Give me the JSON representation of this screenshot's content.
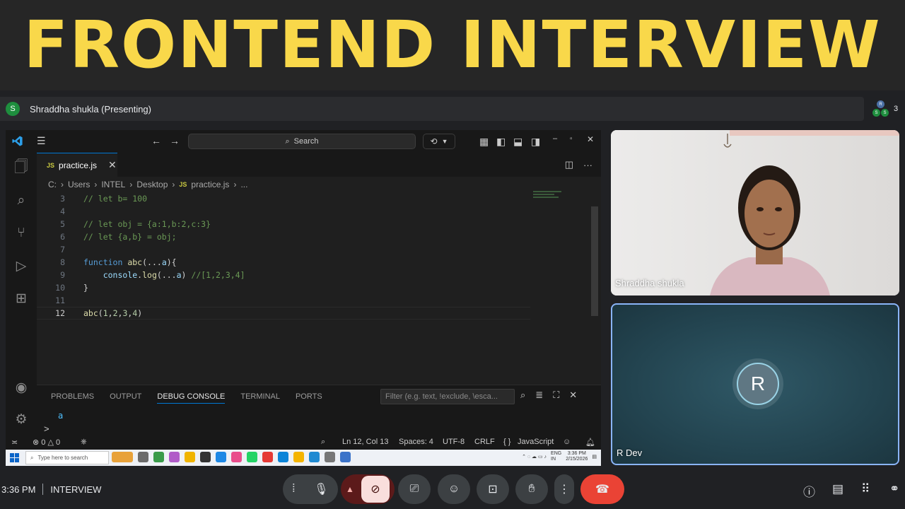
{
  "banner": {
    "title": "FRONTEND INTERVIEW"
  },
  "presenting": {
    "avatar_letter": "S",
    "label": "Shraddha shukla (Presenting)",
    "participant_count": "3",
    "cluster_letters": [
      "R",
      "S",
      "S"
    ]
  },
  "vscode": {
    "search_placeholder": "Search",
    "tab": {
      "badge": "JS",
      "label": "practice.js"
    },
    "breadcrumb": [
      "C:",
      "Users",
      "INTEL",
      "Desktop",
      "practice.js",
      "..."
    ],
    "breadcrumb_badge": "JS",
    "lines": [
      {
        "num": "3",
        "tokens": [
          {
            "t": "// let b= 100",
            "c": "c-comment"
          }
        ]
      },
      {
        "num": "4",
        "tokens": []
      },
      {
        "num": "5",
        "tokens": [
          {
            "t": "// let obj = {a:1,b:2,c:3}",
            "c": "c-comment"
          }
        ]
      },
      {
        "num": "6",
        "tokens": [
          {
            "t": "// let {a,b} = obj;",
            "c": "c-comment"
          }
        ]
      },
      {
        "num": "7",
        "tokens": []
      },
      {
        "num": "8",
        "tokens": [
          {
            "t": "function",
            "c": "c-kw"
          },
          {
            "t": " ",
            "c": "c-plain"
          },
          {
            "t": "abc",
            "c": "c-fn"
          },
          {
            "t": "(...",
            "c": "c-plain"
          },
          {
            "t": "a",
            "c": "c-id"
          },
          {
            "t": "){",
            "c": "c-plain"
          }
        ]
      },
      {
        "num": "9",
        "tokens": [
          {
            "t": "    ",
            "c": "c-plain"
          },
          {
            "t": "console",
            "c": "c-id"
          },
          {
            "t": ".",
            "c": "c-plain"
          },
          {
            "t": "log",
            "c": "c-fn"
          },
          {
            "t": "(...",
            "c": "c-plain"
          },
          {
            "t": "a",
            "c": "c-id"
          },
          {
            "t": ") ",
            "c": "c-plain"
          },
          {
            "t": "//[1,2,3,4]",
            "c": "c-comment"
          }
        ]
      },
      {
        "num": "10",
        "tokens": [
          {
            "t": "}",
            "c": "c-plain"
          }
        ]
      },
      {
        "num": "11",
        "tokens": []
      },
      {
        "num": "12",
        "tokens": [
          {
            "t": "abc",
            "c": "c-fn"
          },
          {
            "t": "(",
            "c": "c-plain"
          },
          {
            "t": "1",
            "c": "c-num"
          },
          {
            "t": ",",
            "c": "c-plain"
          },
          {
            "t": "2",
            "c": "c-num"
          },
          {
            "t": ",",
            "c": "c-plain"
          },
          {
            "t": "3",
            "c": "c-num"
          },
          {
            "t": ",",
            "c": "c-plain"
          },
          {
            "t": "4",
            "c": "c-num"
          },
          {
            "t": ")",
            "c": "c-plain"
          }
        ]
      }
    ],
    "active_line": "12",
    "panel_tabs": [
      "PROBLEMS",
      "OUTPUT",
      "DEBUG CONSOLE",
      "TERMINAL",
      "PORTS"
    ],
    "active_panel_tab": "DEBUG CONSOLE",
    "filter_placeholder": "Filter (e.g. text, !exclude, \\esca...",
    "console_output": "a",
    "console_prompt": ">",
    "status": {
      "errors": "0",
      "warnings": "0",
      "position": "Ln 12, Col 13",
      "spaces": "Spaces: 4",
      "encoding": "UTF-8",
      "eol": "CRLF",
      "language_braces": "{ }",
      "language": "JavaScript"
    },
    "taskbar": {
      "search_placeholder": "Type here to search",
      "lang": "ENG",
      "region": "IN",
      "time": "3:36 PM",
      "date": "2/15/2026"
    }
  },
  "tiles": [
    {
      "name": "Shraddha shukla"
    },
    {
      "name": "R Dev",
      "avatar_letter": "R"
    }
  ],
  "meet": {
    "time": "3:36 PM",
    "meeting_name": "INTERVIEW"
  },
  "icons": [
    "vscode-icon",
    "menu-icon",
    "back-icon",
    "forward-icon",
    "search-icon",
    "copilot-icon",
    "layout-icon",
    "explorer-icon",
    "scm-icon",
    "debug-icon",
    "extensions-icon",
    "account-icon",
    "settings-icon",
    "mic-icon",
    "camera-off-icon",
    "present-icon",
    "emoji-icon",
    "captions-icon",
    "hand-icon",
    "more-icon",
    "end-call-icon",
    "info-icon",
    "chat-icon",
    "apps-icon",
    "activities-icon"
  ]
}
